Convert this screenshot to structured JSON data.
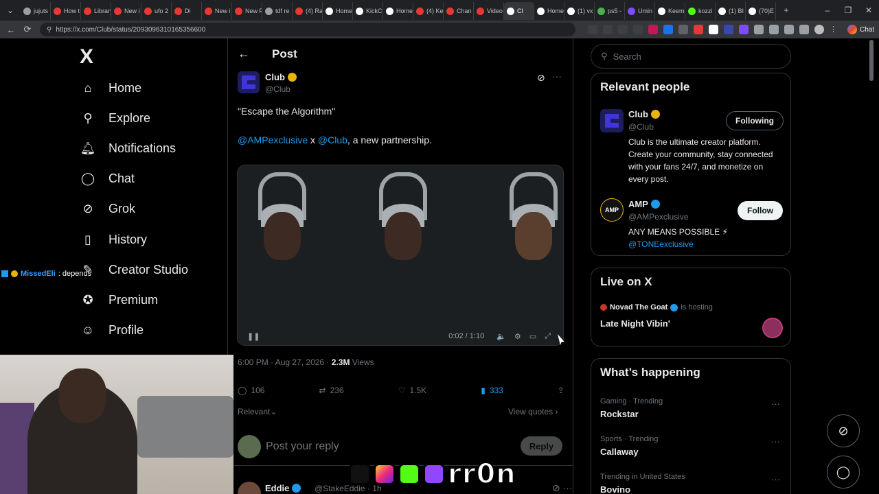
{
  "browser": {
    "tabs": [
      {
        "label": "jujuts",
        "color": "#9aa0a6"
      },
      {
        "label": "How t",
        "color": "#e53935"
      },
      {
        "label": "Library",
        "color": "#e53935"
      },
      {
        "label": "New i",
        "color": "#e53935"
      },
      {
        "label": "ufo 2",
        "color": "#e53935"
      },
      {
        "label": "Di",
        "color": "#e53935"
      },
      {
        "label": "New i",
        "color": "#e53935"
      },
      {
        "label": "New F",
        "color": "#e53935"
      },
      {
        "label": "tdf re",
        "color": "#9aa0a6"
      },
      {
        "label": "(4) Ra",
        "color": "#e53935"
      },
      {
        "label": "Home",
        "color": "#ffffff"
      },
      {
        "label": "KickCl",
        "color": "#ffffff"
      },
      {
        "label": "Home",
        "color": "#ffffff"
      },
      {
        "label": "(4) Ke",
        "color": "#e53935"
      },
      {
        "label": "Chan",
        "color": "#e53935"
      },
      {
        "label": "Video",
        "color": "#e53935"
      },
      {
        "label": "Cl",
        "color": "#ffffff",
        "active": true
      },
      {
        "label": "Home",
        "color": "#ffffff"
      },
      {
        "label": "(1) vx",
        "color": "#ffffff"
      },
      {
        "label": "ps5 -",
        "color": "#4caf50"
      },
      {
        "label": "Umin",
        "color": "#7c4dff"
      },
      {
        "label": "Keem",
        "color": "#ffffff"
      },
      {
        "label": "kozzi",
        "color": "#53fc18"
      },
      {
        "label": "(1) BI",
        "color": "#ffffff"
      },
      {
        "label": "(70)E",
        "color": "#ffffff"
      }
    ],
    "url": "https://x.com/Club/status/2093096310165356600",
    "chat_label": "Chat"
  },
  "nav": {
    "logo": "X",
    "items": [
      {
        "label": "Home",
        "icon": "home-icon"
      },
      {
        "label": "Explore",
        "icon": "search-icon"
      },
      {
        "label": "Notifications",
        "icon": "bell-icon"
      },
      {
        "label": "Chat",
        "icon": "chat-icon"
      },
      {
        "label": "Grok",
        "icon": "grok-icon"
      },
      {
        "label": "History",
        "icon": "bookmark-icon"
      },
      {
        "label": "Creator Studio",
        "icon": "creator-icon"
      },
      {
        "label": "Premium",
        "icon": "premium-icon"
      },
      {
        "label": "Profile",
        "icon": "person-icon"
      }
    ]
  },
  "stream_overlay": {
    "chat_user": "MissedEli",
    "chat_message": ": depends",
    "watermark": "rr0n"
  },
  "post": {
    "header_title": "Post",
    "author_name": "Club",
    "author_handle": "@Club",
    "line1": "\"Escape the Algorithm\"",
    "mention1": "@AMPexclusive",
    "x_sep": " x ",
    "mention2": "@Club",
    "line2_rest": ", a new partnership.",
    "video_time": "0:02 / 1:10",
    "timestamp": "6:00 PM · Aug 27, 2026 · ",
    "views_count": "2.3M",
    "views_label": " Views",
    "replies": "106",
    "reposts": "236",
    "likes": "1.5K",
    "bookmarks": "333",
    "sort_label": "Relevant",
    "view_quotes": "View quotes",
    "reply_placeholder": "Post your reply",
    "reply_button": "Reply"
  },
  "reply_preview": {
    "name": "Eddie",
    "handle": "@StakeEddie · 1h"
  },
  "sidebar": {
    "search_placeholder": "Search",
    "relevant_title": "Relevant people",
    "people": [
      {
        "name": "Club",
        "handle": "@Club",
        "button": "Following",
        "bio": "Club is the ultimate creator platform. Create your community, stay connected with your fans 24/7, and monetize on every post."
      },
      {
        "name": "AMP",
        "handle": "@AMPexclusive",
        "button": "Follow",
        "bio": "ANY MEANS POSSIBLE ⚡",
        "bio_mention": "@TONEexclusive"
      }
    ],
    "live_title": "Live on X",
    "live_host": "Novad The Goat",
    "live_hosting": "is hosting",
    "live_space": "Late Night Vibin'",
    "happening_title": "What’s happening",
    "trends": [
      {
        "category": "Gaming · Trending",
        "name": "Rockstar"
      },
      {
        "category": "Sports · Trending",
        "name": "Callaway"
      },
      {
        "category": "Trending in United States",
        "name": "Bovino"
      }
    ]
  }
}
